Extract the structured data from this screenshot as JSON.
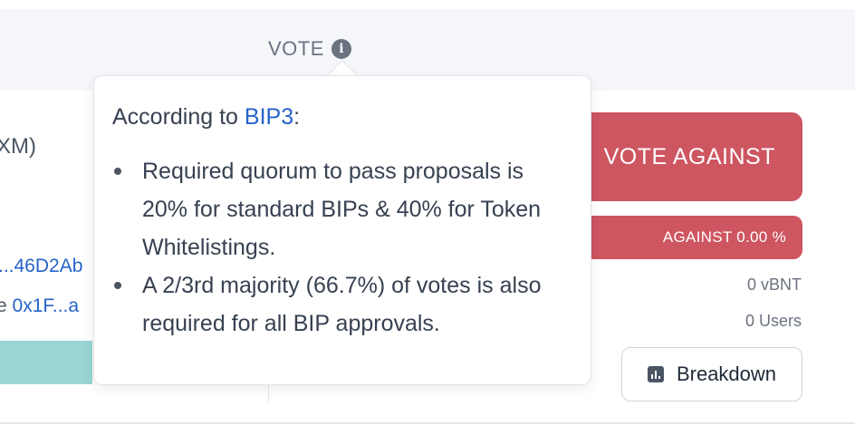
{
  "header": {
    "vote_label": "VOTE",
    "info_icon": "info-icon"
  },
  "left": {
    "method_fragment": "XM)",
    "link_fragment": "...46D2Ab",
    "line2_prefix": "e ",
    "line2_addr": "0x1F...a"
  },
  "tooltip": {
    "intro_prefix": "According to ",
    "intro_link": "BIP3",
    "intro_suffix": ":",
    "bullets": [
      "Required quorum to pass proposals is 20% for standard BIPs & 40% for Token Whitelistings.",
      "A 2/3rd majority (66.7%) of votes is also required for all BIP approvals."
    ]
  },
  "vote": {
    "against_button": "VOTE AGAINST",
    "against_bar_label": "AGAINST 0.00 %",
    "against_percent": 0.0,
    "vbnt": "0 vBNT",
    "users": "0 Users",
    "breakdown_label": "Breakdown",
    "breakdown_icon": "bar-chart-icon"
  },
  "colors": {
    "against": "#cd5661",
    "link": "#2563c9",
    "teal": "#99d6d4",
    "header_bg": "#f5f7fb"
  }
}
